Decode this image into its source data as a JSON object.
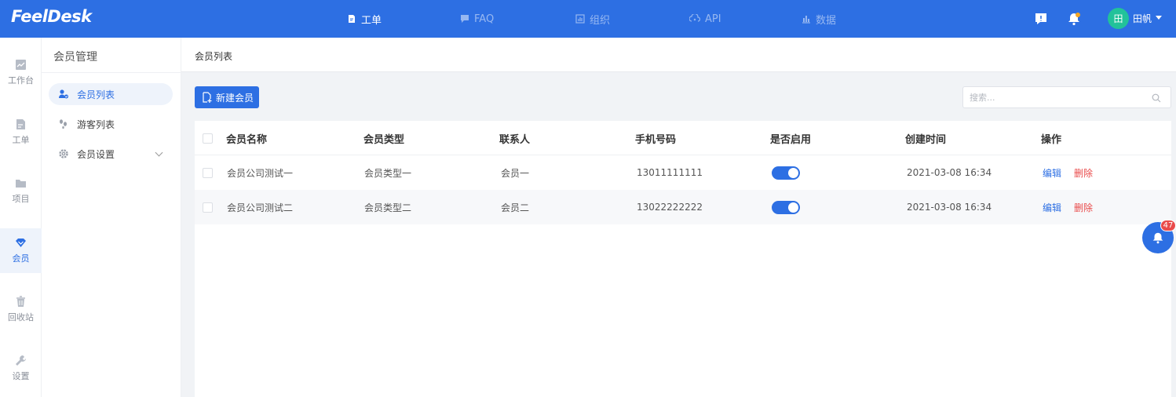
{
  "app": {
    "logo": "FeelDesk"
  },
  "topnav": [
    {
      "label": "工单",
      "icon": "ticket-icon",
      "active": true
    },
    {
      "label": "FAQ",
      "icon": "faq-icon",
      "active": false
    },
    {
      "label": "组织",
      "icon": "org-icon",
      "active": false
    },
    {
      "label": "API",
      "icon": "api-icon",
      "active": false
    },
    {
      "label": "数据",
      "icon": "data-icon",
      "active": false
    }
  ],
  "user": {
    "avatar": "田",
    "name": "田帆"
  },
  "rail": [
    {
      "label": "工作台",
      "icon": "dashboard-icon"
    },
    {
      "label": "工单",
      "icon": "ticket-icon"
    },
    {
      "label": "项目",
      "icon": "folder-icon"
    },
    {
      "label": "会员",
      "icon": "member-icon",
      "active": true
    },
    {
      "label": "回收站",
      "icon": "trash-icon"
    },
    {
      "label": "设置",
      "icon": "wrench-icon"
    }
  ],
  "subnav": {
    "title": "会员管理",
    "items": [
      {
        "label": "会员列表",
        "icon": "member-list-icon",
        "active": true
      },
      {
        "label": "游客列表",
        "icon": "visitor-icon"
      },
      {
        "label": "会员设置",
        "icon": "settings-icon"
      }
    ]
  },
  "breadcrumb": "会员列表",
  "toolbar": {
    "new_label": "新建会员",
    "search_placeholder": "搜索..."
  },
  "table": {
    "columns": [
      "会员名称",
      "会员类型",
      "联系人",
      "手机号码",
      "是否启用",
      "创建时间",
      "操作"
    ],
    "rows": [
      {
        "name": "会员公司测试一",
        "type": "会员类型一",
        "contact": "会员一",
        "phone": "13011111111",
        "enabled": true,
        "created": "2021-03-08 16:34",
        "edit": "编辑",
        "delete": "删除"
      },
      {
        "name": "会员公司测试二",
        "type": "会员类型二",
        "contact": "会员二",
        "phone": "13022222222",
        "enabled": true,
        "created": "2021-03-08 16:34",
        "edit": "编辑",
        "delete": "删除"
      }
    ]
  },
  "notifications": {
    "count": "47"
  },
  "colors": {
    "primary": "#2d6fe3",
    "danger": "#e94b4b",
    "avatar": "#22c29a",
    "dot": "#f5a623"
  }
}
